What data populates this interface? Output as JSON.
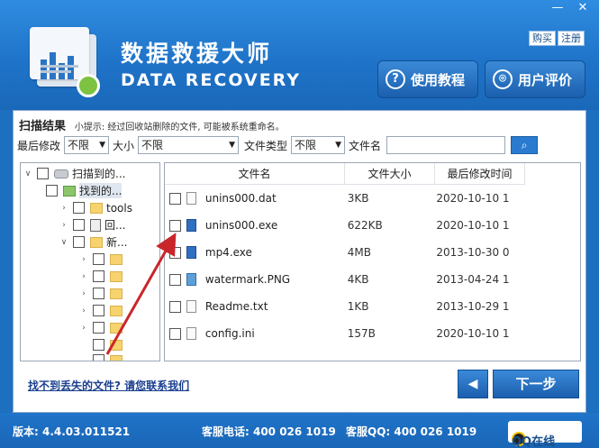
{
  "window": {
    "minimize": "—",
    "close": "✕"
  },
  "header": {
    "title_cn": "数据救援大师",
    "title_en": "DATA RECOVERY",
    "buy_label": "购买",
    "register_label": "注册",
    "tutorial_label": "使用教程",
    "tutorial_icon": "?",
    "review_label": "用户评价"
  },
  "scan": {
    "result_label": "扫描结果",
    "hint": "小提示: 经过回收站删除的文件, 可能被系统重命名。"
  },
  "filters": {
    "modified_label": "最后修改",
    "modified_value": "不限",
    "size_label": "大小",
    "size_value": "不限",
    "type_label": "文件类型",
    "type_value": "不限",
    "name_label": "文件名",
    "name_value": "",
    "search_icon": "search-icon"
  },
  "tree": {
    "items": [
      {
        "label": "扫描到的..."
      },
      {
        "label": "找到的..."
      },
      {
        "label": "tools"
      },
      {
        "label": "回..."
      },
      {
        "label": "新..."
      }
    ]
  },
  "files": {
    "columns": [
      "文件名",
      "文件大小",
      "最后修改时间"
    ],
    "rows": [
      {
        "name": "unins000.dat",
        "size": "3KB",
        "date": "2020-10-10 1"
      },
      {
        "name": "unins000.exe",
        "size": "622KB",
        "date": "2020-10-10 1"
      },
      {
        "name": "mp4.exe",
        "size": "4MB",
        "date": "2013-10-30 0"
      },
      {
        "name": "watermark.PNG",
        "size": "4KB",
        "date": "2013-04-24 1"
      },
      {
        "name": "Readme.txt",
        "size": "1KB",
        "date": "2013-10-29 1"
      },
      {
        "name": "config.ini",
        "size": "157B",
        "date": "2020-10-10 1"
      }
    ]
  },
  "actions": {
    "contact_link": "找不到丢失的文件? 请您联系我们",
    "back_label": "◀",
    "next_label": "下一步"
  },
  "footer": {
    "version": "版本: 4.4.03.011521",
    "phone": "客服电话: 400 026 1019",
    "qq": "客服QQ: 400 026 1019",
    "qq_online": "QQ在线"
  }
}
